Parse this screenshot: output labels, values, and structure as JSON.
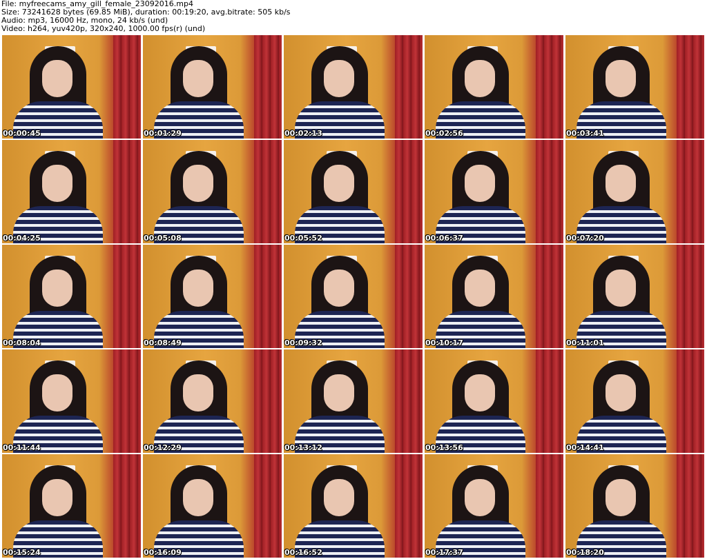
{
  "header": {
    "file_line": "File: myfreecams_amy_gill_female_23092016.mp4",
    "size_line": "Size: 73241628 bytes (69.85 MiB), duration: 00:19:20, avg.bitrate: 505 kb/s",
    "audio_line": "Audio: mp3, 16000 Hz, mono, 24 kb/s (und)",
    "video_line": "Video: h264, yuv420p, 320x240, 1000.00 fps(r) (und)"
  },
  "thumbnails": [
    {
      "timestamp": "00:00:45"
    },
    {
      "timestamp": "00:01:29"
    },
    {
      "timestamp": "00:02:13"
    },
    {
      "timestamp": "00:02:56"
    },
    {
      "timestamp": "00:03:41"
    },
    {
      "timestamp": "00:04:25"
    },
    {
      "timestamp": "00:05:08"
    },
    {
      "timestamp": "00:05:52"
    },
    {
      "timestamp": "00:06:37"
    },
    {
      "timestamp": "00:07:20"
    },
    {
      "timestamp": "00:08:04"
    },
    {
      "timestamp": "00:08:49"
    },
    {
      "timestamp": "00:09:32"
    },
    {
      "timestamp": "00:10:17"
    },
    {
      "timestamp": "00:11:01"
    },
    {
      "timestamp": "00:11:44"
    },
    {
      "timestamp": "00:12:29"
    },
    {
      "timestamp": "00:13:12"
    },
    {
      "timestamp": "00:13:56"
    },
    {
      "timestamp": "00:14:41"
    },
    {
      "timestamp": "00:15:24"
    },
    {
      "timestamp": "00:16:09"
    },
    {
      "timestamp": "00:16:52"
    },
    {
      "timestamp": "00:17:37"
    },
    {
      "timestamp": "00:18:20"
    }
  ]
}
